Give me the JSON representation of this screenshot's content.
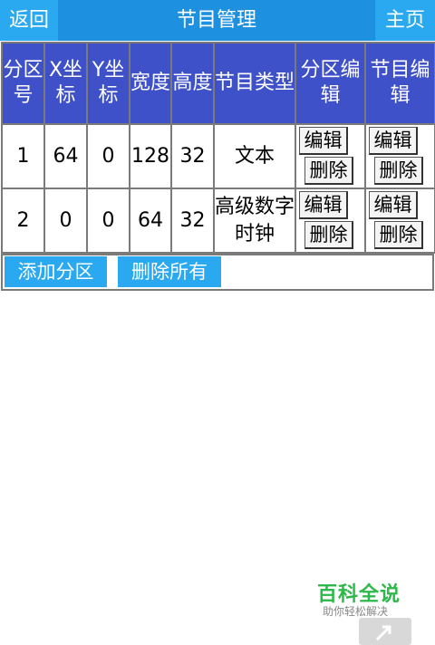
{
  "topbar": {
    "back_label": "返回",
    "title": "节目管理",
    "home_label": "主页"
  },
  "table": {
    "headers": [
      "分区号",
      "X坐标",
      "Y坐标",
      "宽度",
      "高度",
      "节目类型",
      "分区编辑",
      "节目编辑"
    ],
    "rows": [
      {
        "id": "1",
        "x": "64",
        "y": "0",
        "width": "128",
        "height": "32",
        "type": "文本"
      },
      {
        "id": "2",
        "x": "0",
        "y": "0",
        "width": "64",
        "height": "32",
        "type": "高级数字时钟"
      }
    ],
    "edit_label": "编辑",
    "delete_label": "删除"
  },
  "actions": {
    "add_label": "添加分区",
    "delete_all_label": "删除所有"
  },
  "watermark": {
    "title": "百科全说",
    "subtitle": "助你轻松解决"
  },
  "colors": {
    "topbar": "#1e90e0",
    "button": "#2aa8f0",
    "header": "#3f51c8"
  }
}
